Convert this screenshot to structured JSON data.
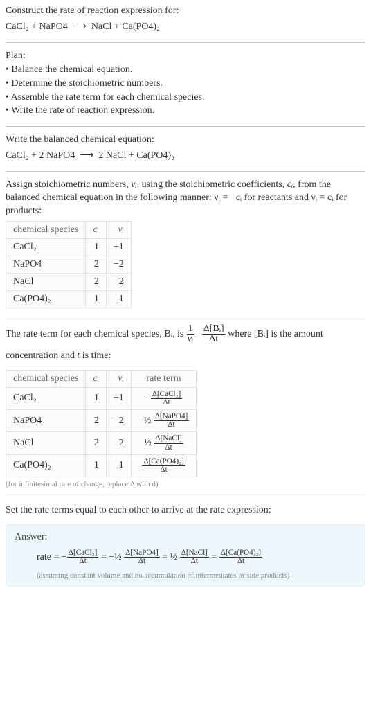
{
  "intro": {
    "construct": "Construct the rate of reaction expression for:",
    "reaction_lhs": "CaCl₂ + NaPO4",
    "arrow": "⟶",
    "reaction_rhs": "NaCl + Ca(PO4)₂"
  },
  "plan": {
    "header": "Plan:",
    "bullets": [
      "• Balance the chemical equation.",
      "• Determine the stoichiometric numbers.",
      "• Assemble the rate term for each chemical species.",
      "• Write the rate of reaction expression."
    ]
  },
  "balanced": {
    "header": "Write the balanced chemical equation:",
    "reaction_lhs": "CaCl₂ + 2 NaPO4",
    "arrow": "⟶",
    "reaction_rhs": "2 NaCl + Ca(PO4)₂"
  },
  "assign": {
    "text_pre": "Assign stoichiometric numbers, ",
    "vi": "νᵢ",
    "text_mid": ", using the stoichiometric coefficients, ",
    "ci": "cᵢ",
    "text_rest": ", from the balanced chemical equation in the following manner: νᵢ = −cᵢ for reactants and νᵢ = cᵢ for products:"
  },
  "table1": {
    "headers": [
      "chemical species",
      "cᵢ",
      "νᵢ"
    ],
    "rows": [
      {
        "species": "CaCl₂",
        "c": "1",
        "v": "−1"
      },
      {
        "species": "NaPO4",
        "c": "2",
        "v": "−2"
      },
      {
        "species": "NaCl",
        "c": "2",
        "v": "2"
      },
      {
        "species": "Ca(PO4)₂",
        "c": "1",
        "v": "1"
      }
    ]
  },
  "rateterm": {
    "text_pre": "The rate term for each chemical species, Bᵢ, is ",
    "frac1_num": "1",
    "frac1_den": "νᵢ",
    "frac2_num": "Δ[Bᵢ]",
    "frac2_den": "Δt",
    "text_mid": " where [Bᵢ] is the amount concentration and ",
    "t": "t",
    "text_end": " is time:"
  },
  "table2": {
    "headers": [
      "chemical species",
      "cᵢ",
      "νᵢ",
      "rate term"
    ],
    "rows": [
      {
        "species": "CaCl₂",
        "c": "1",
        "v": "−1",
        "lead": "−",
        "num": "Δ[CaCl₂]",
        "den": "Δt"
      },
      {
        "species": "NaPO4",
        "c": "2",
        "v": "−2",
        "lead": "−½ ",
        "num": "Δ[NaPO4]",
        "den": "Δt"
      },
      {
        "species": "NaCl",
        "c": "2",
        "v": "2",
        "lead": "½ ",
        "num": "Δ[NaCl]",
        "den": "Δt"
      },
      {
        "species": "Ca(PO4)₂",
        "c": "1",
        "v": "1",
        "lead": "",
        "num": "Δ[Ca(PO4)₂]",
        "den": "Δt"
      }
    ],
    "footnote": "(for infinitesimal rate of change, replace Δ with d)"
  },
  "setequal": "Set the rate terms equal to each other to arrive at the rate expression:",
  "answer": {
    "label": "Answer:",
    "rate": "rate = ",
    "dt": "Δt",
    "neg": "−",
    "neg_half": "−½ ",
    "half": "½ ",
    "n1": "Δ[CaCl₂]",
    "n2": "Δ[NaPO4]",
    "n3": "Δ[NaCl]",
    "n4": "Δ[Ca(PO4)₂]",
    "eq": " = ",
    "assume": "(assuming constant volume and no accumulation of intermediates or side products)"
  },
  "chart_data": {
    "type": "table",
    "tables": [
      {
        "title": "stoichiometric numbers",
        "columns": [
          "chemical species",
          "c_i",
          "ν_i"
        ],
        "rows": [
          [
            "CaCl2",
            1,
            -1
          ],
          [
            "NaPO4",
            2,
            -2
          ],
          [
            "NaCl",
            2,
            2
          ],
          [
            "Ca(PO4)2",
            1,
            1
          ]
        ]
      },
      {
        "title": "rate terms",
        "columns": [
          "chemical species",
          "c_i",
          "ν_i",
          "rate term"
        ],
        "rows": [
          [
            "CaCl2",
            1,
            -1,
            "-Δ[CaCl2]/Δt"
          ],
          [
            "NaPO4",
            2,
            -2,
            "-(1/2) Δ[NaPO4]/Δt"
          ],
          [
            "NaCl",
            2,
            2,
            "(1/2) Δ[NaCl]/Δt"
          ],
          [
            "Ca(PO4)2",
            1,
            1,
            "Δ[Ca(PO4)2]/Δt"
          ]
        ]
      }
    ],
    "rate_expression": "rate = -Δ[CaCl2]/Δt = -(1/2) Δ[NaPO4]/Δt = (1/2) Δ[NaCl]/Δt = Δ[Ca(PO4)2]/Δt"
  }
}
